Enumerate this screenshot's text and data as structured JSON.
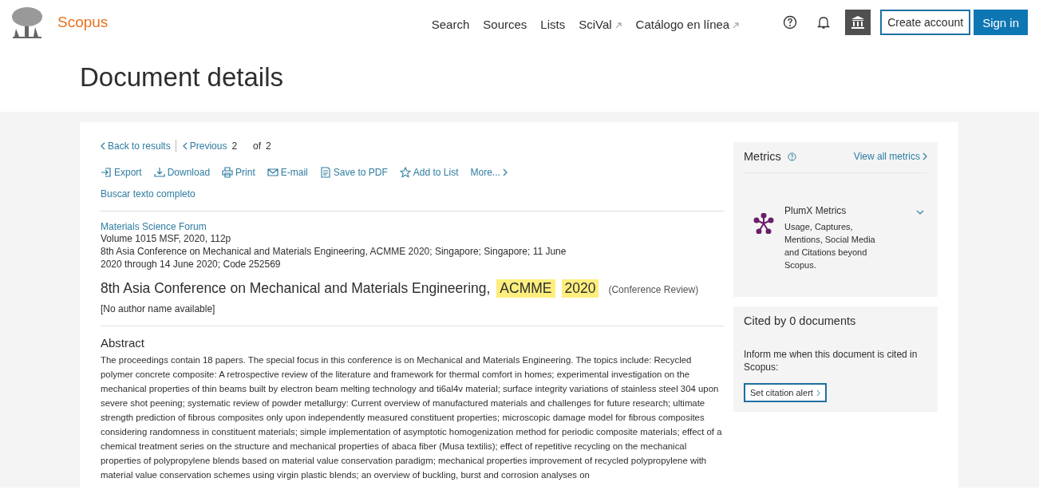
{
  "header": {
    "brand": "Scopus",
    "nav": [
      {
        "label": "Search",
        "external": false
      },
      {
        "label": "Sources",
        "external": false
      },
      {
        "label": "Lists",
        "external": false
      },
      {
        "label": "SciVal",
        "external": true
      },
      {
        "label": "Catálogo en línea",
        "external": true
      }
    ],
    "buttons": [
      {
        "label": "Create account",
        "kind": "outline"
      },
      {
        "label": "Sign in",
        "kind": "primary"
      }
    ]
  },
  "page_title": "Document details",
  "pager": {
    "back": "Back to results",
    "previous": "Previous",
    "current": "2",
    "of": "of",
    "total": "2"
  },
  "actions": [
    {
      "label": "Export",
      "kind": "export"
    },
    {
      "label": "Download",
      "kind": "download"
    },
    {
      "label": "Print",
      "kind": "print"
    },
    {
      "label": "E-mail",
      "kind": "email"
    },
    {
      "label": "Save to PDF",
      "kind": "pdf"
    },
    {
      "label": "Add to List",
      "kind": "star"
    },
    {
      "label": "More...",
      "kind": "more"
    }
  ],
  "fulltext_link": "Buscar texto completo",
  "source": {
    "title": "Materials Science Forum",
    "volume": "Volume 1015 MSF, 2020, 112p",
    "conference": "8th Asia Conference on Mechanical and Materials Engineering, ACMME 2020; Singapore; Singapore; 11 June 2020 through 14 June 2020; Code 252569"
  },
  "document_title": [
    {
      "text": "8th Asia Conference on Mechanical and Materials Engineering,",
      "highlighted": false
    },
    {
      "text": "ACMME",
      "highlighted": true
    },
    {
      "text": "2020",
      "highlighted": true
    }
  ],
  "document_type": "(Conference Review)",
  "authors": "[No author name available]",
  "abstract": {
    "heading": "Abstract",
    "text": "The proceedings contain 18 papers. The special focus in this conference is on Mechanical and Materials Engineering. The topics include: Recycled polymer concrete composite: A retrospective review of the literature and framework for thermal comfort in homes; experimental investigation on the mechanical properties of thin beams built by electron beam melting technology and ti6al4v material; surface integrity variations of stainless steel 304 upon severe shot peening; systematic review of powder metallurgy: Current overview of manufactured materials and challenges for future research; ultimate strength prediction of fibrous composites only upon independently measured constituent properties; microscopic damage model for fibrous composites considering randomness in constituent materials; simple implementation of asymptotic homogenization method for periodic composite materials; effect of a chemical treatment series on the structure and mechanical properties of abaca fiber (Musa textilis); effect of repetitive recycling on the mechanical properties of polypropylene blends based on material value conservation paradigm; mechanical properties improvement of recycled polypropylene with material value conservation schemes using virgin plastic blends; an overview of buckling, burst and corrosion analyses on"
  },
  "metrics": {
    "heading": "Metrics",
    "view_all": "View all metrics",
    "plumx": {
      "title": "PlumX Metrics",
      "description": "Usage, Captures, Mentions, Social Media and Citations beyond Scopus.",
      "expanded": false
    }
  },
  "cited_by": {
    "heading": "Cited by 0 documents",
    "text": "Inform me when this document is cited in Scopus:",
    "button": "Set citation alert"
  }
}
